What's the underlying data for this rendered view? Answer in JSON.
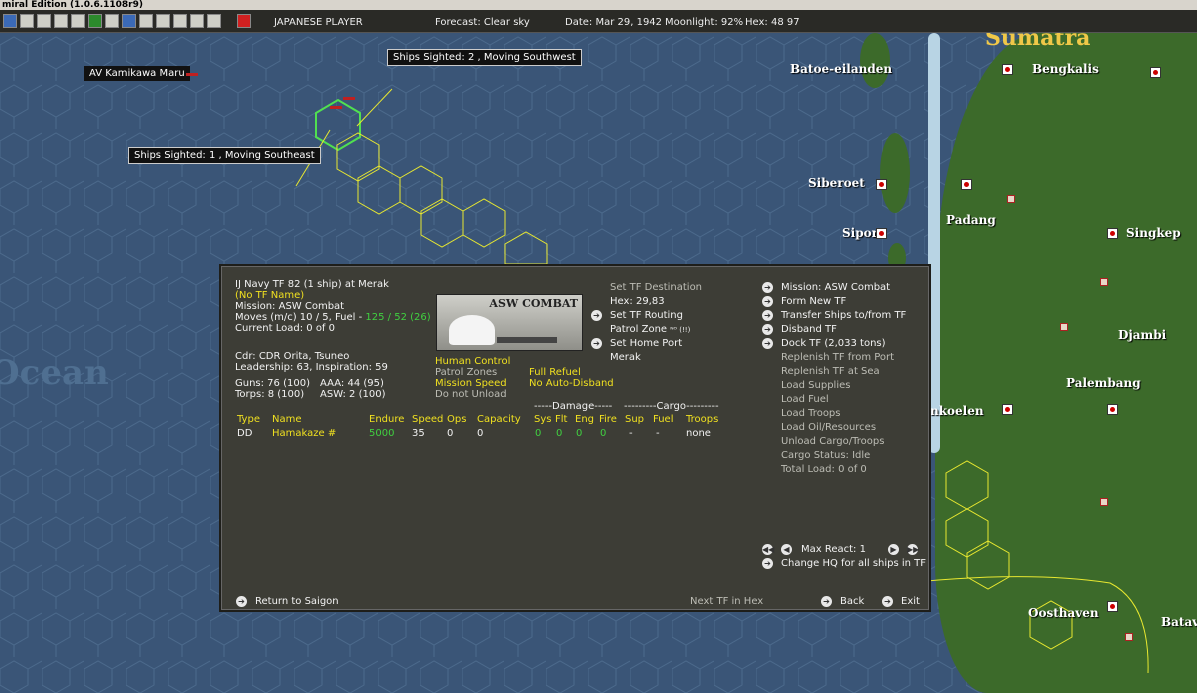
{
  "window": {
    "title": "miral Edition (1.0.6.1108r9)"
  },
  "toolbar": {
    "player": "JAPANESE PLAYER",
    "forecast": "Forecast: Clear sky",
    "date": "Date: Mar 29, 1942",
    "moonlight": "Moonlight: 92%",
    "hex": "Hex: 48 97"
  },
  "map": {
    "labels": {
      "sumatra": "Sumatra",
      "ocean": "Ocean",
      "batoe": "Batoe-eilanden",
      "bengkalis": "Bengkalis",
      "siberoet": "Siberoet",
      "padang": "Padang",
      "singkep": "Singkep",
      "sipora": "Sipora",
      "djambi": "Djambi",
      "palembang": "Palembang",
      "benkoelen": "nkoelen",
      "oosthaven": "Oosthaven",
      "batavia": "Batavi"
    },
    "tooltips": {
      "kamikawa": "AV Kamikawa Maru",
      "sighted2": "Ships Sighted: 2 , Moving Southwest",
      "sighted1": "Ships Sighted: 1 , Moving Southeast"
    }
  },
  "tf": {
    "header": "IJ Navy TF 82 (1 ship) at Merak",
    "name_status": "(No TF Name)",
    "mission": "Mission: ASW Combat",
    "moves_prefix": "Moves (m/c)  10 / 5, Fuel - ",
    "fuel": "125 / 52 (26)",
    "current_load": "Current Load: 0 of 0",
    "commander": "Cdr: CDR  Orita, Tsuneo",
    "leadership": "Leadership: 63, Inspiration: 59",
    "guns": "Guns: 76 (100)",
    "aaa": "AAA: 44 (95)",
    "torps": "Torps: 8 (100)",
    "asw": "ASW: 2 (100)",
    "picture_label": "ASW COMBAT",
    "settings": {
      "human_control": "Human Control",
      "patrol_zones": "Patrol Zones",
      "mission_speed": "Mission Speed",
      "do_not_unload": "Do not Unload",
      "full_refuel": "Full Refuel",
      "no_auto_disband": "No Auto-Disband"
    },
    "routing": {
      "set_destination": "Set TF Destination",
      "hex": "Hex: 29,83",
      "set_routing": "Set TF Routing",
      "patrol_zone": "Patrol Zone",
      "patrol_marks": "ᴺᴼ (!!)",
      "set_home_port": "Set Home Port",
      "home_port": "Merak"
    },
    "table": {
      "damage_header": "-----Damage-----",
      "cargo_header": "---------Cargo---------",
      "columns": [
        "Type",
        "Name",
        "Endure",
        "Speed",
        "Ops",
        "Capacity",
        "Sys",
        "Flt",
        "Eng",
        "Fire",
        "Sup",
        "Fuel",
        "Troops"
      ],
      "rows": [
        {
          "type": "DD",
          "name": "Hamakaze #",
          "endure": "5000",
          "speed": "35",
          "ops": "0",
          "capacity": "0",
          "sys": "0",
          "flt": "0",
          "eng": "0",
          "fire": "0",
          "sup": "-",
          "fuel": "-",
          "troops": "none"
        }
      ]
    },
    "actions": {
      "mission": "Mission: ASW Combat",
      "form_new": "Form New TF",
      "transfer": "Transfer Ships to/from TF",
      "disband": "Disband TF",
      "dock": "Dock TF (2,033 tons)",
      "replenish_port": "Replenish TF from Port",
      "replenish_sea": "Replenish TF at Sea",
      "load_supplies": "Load Supplies",
      "load_fuel": "Load Fuel",
      "load_troops": "Load Troops",
      "load_oil": "Load Oil/Resources",
      "unload": "Unload Cargo/Troops",
      "cargo_status": "Cargo Status: Idle",
      "total_load": "Total Load: 0 of 0"
    },
    "max_react": "Max React:  1",
    "change_hq": "Change HQ for all ships in TF",
    "return": "Return to Saigon",
    "next_tf": "Next TF in Hex",
    "back": "Back",
    "exit": "Exit"
  },
  "colors": {
    "sea": "#3a5577",
    "land": "#3c6a2a",
    "panel": "#3d3d36",
    "highlight": "#f0e020",
    "good": "#40d040"
  }
}
